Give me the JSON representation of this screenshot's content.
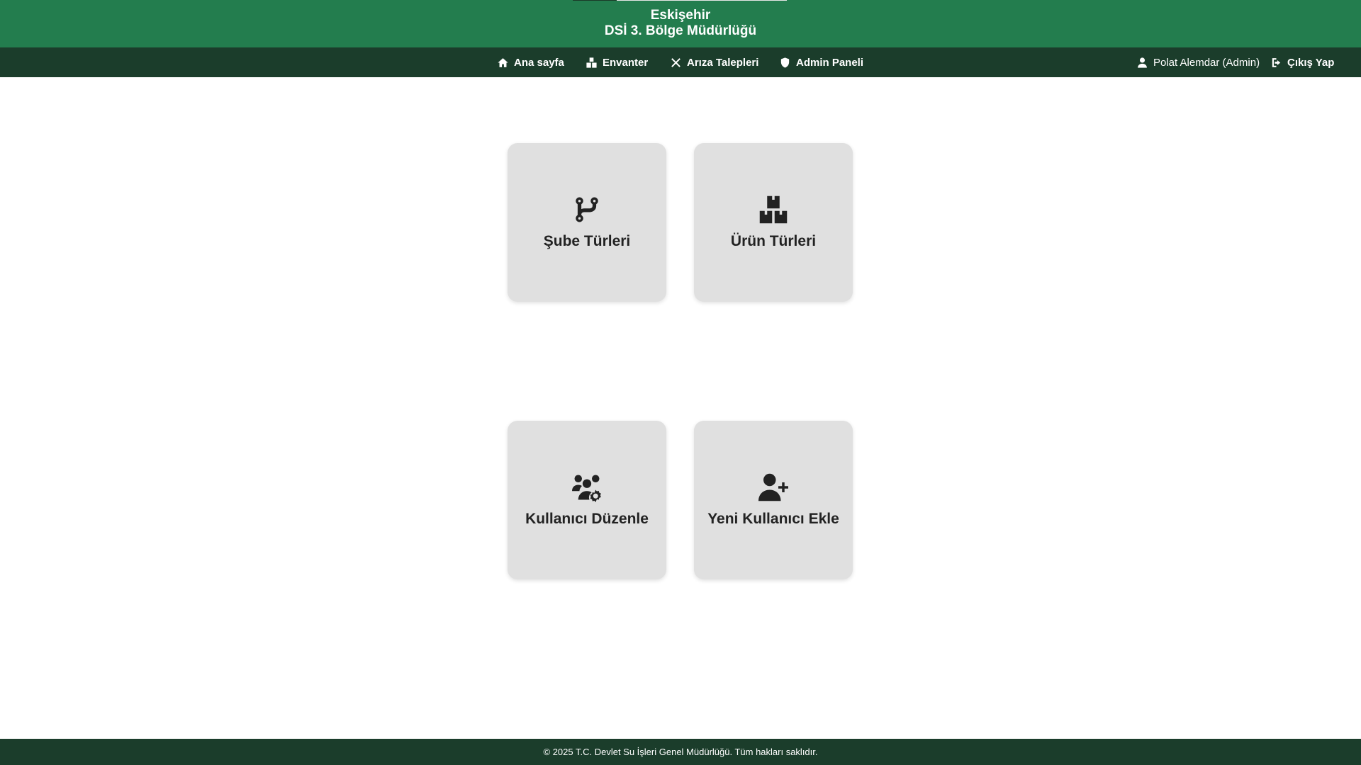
{
  "header": {
    "city": "Eskişehir",
    "organization": "DSİ 3. Bölge Müdürlüğü"
  },
  "nav": {
    "items": [
      {
        "label": "Ana sayfa",
        "icon": "home-icon"
      },
      {
        "label": "Envanter",
        "icon": "boxes-icon"
      },
      {
        "label": "Arıza Talepleri",
        "icon": "tools-icon"
      },
      {
        "label": "Admin Paneli",
        "icon": "shield-icon"
      }
    ],
    "user_label": "Polat Alemdar (Admin)",
    "logout_label": "Çıkış Yap"
  },
  "cards": [
    {
      "label": "Şube Türleri",
      "icon": "code-branch-icon"
    },
    {
      "label": "Ürün Türleri",
      "icon": "boxes-icon"
    },
    {
      "label": "Kullanıcı Düzenle",
      "icon": "users-gear-icon"
    },
    {
      "label": "Yeni Kullanıcı Ekle",
      "icon": "user-plus-icon"
    }
  ],
  "footer": {
    "text": "© 2025 T.C. Devlet Su İşleri Genel Müdürlüğü. Tüm hakları saklıdır."
  },
  "colors": {
    "header_green": "#237d4e",
    "nav_dark_green": "#1b3d2b",
    "card_bg": "#e0e0e0",
    "text_dark": "#222222"
  }
}
